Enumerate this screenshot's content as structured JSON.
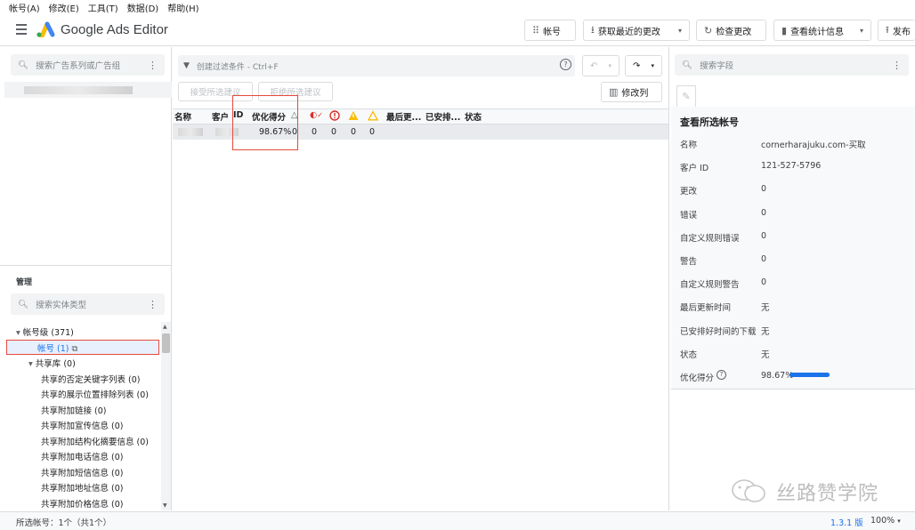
{
  "menu": [
    "帐号(A)",
    "修改(E)",
    "工具(T)",
    "数据(D)",
    "帮助(H)"
  ],
  "app_title": "Google Ads Editor",
  "toolbar": {
    "accounts": "帐号",
    "get_changes": "获取最近的更改",
    "check_changes": "检查更改",
    "view_stats": "查看统计信息",
    "publish": "发布"
  },
  "left": {
    "search_placeholder": "搜索广告系列或广告组",
    "manage_title": "管理",
    "entity_search_placeholder": "搜索实体类型",
    "tree": [
      {
        "label": "帐号级 (371)",
        "indent": 0,
        "arrow": "▾"
      },
      {
        "label": "帐号 (1)",
        "indent": 1,
        "arrow": "",
        "selected": true
      },
      {
        "label": "共享库 (0)",
        "indent": 1,
        "arrow": "▾"
      },
      {
        "label": "共享的否定关键字列表 (0)",
        "indent": 2
      },
      {
        "label": "共享的展示位置排除列表 (0)",
        "indent": 2
      },
      {
        "label": "共享附加链接 (0)",
        "indent": 2
      },
      {
        "label": "共享附加宣传信息 (0)",
        "indent": 2
      },
      {
        "label": "共享附加结构化摘要信息 (0)",
        "indent": 2
      },
      {
        "label": "共享附加电话信息 (0)",
        "indent": 2
      },
      {
        "label": "共享附加短信信息 (0)",
        "indent": 2
      },
      {
        "label": "共享附加地址信息 (0)",
        "indent": 2
      },
      {
        "label": "共享附加价格信息 (0)",
        "indent": 2
      }
    ]
  },
  "center": {
    "filter_placeholder": "创建过滤条件 - Ctrl+F",
    "accept_btn": "接受所选建议",
    "reject_btn": "拒绝所选建议",
    "edit_columns": "修改列",
    "columns": [
      "名称",
      "客户",
      "ID",
      "优化得分",
      "最后更...",
      "已安排...",
      "状态"
    ],
    "row": {
      "score": "98.67%",
      "counts": [
        "0",
        "0",
        "0",
        "0",
        "0"
      ]
    }
  },
  "right": {
    "search_placeholder": "搜索字段",
    "title": "查看所选帐号",
    "fields": [
      {
        "label": "名称",
        "value": "cornerharajuku.com-买取"
      },
      {
        "label": "客户 ID",
        "value": "121-527-5796"
      },
      {
        "label": "更改",
        "value": "0"
      },
      {
        "label": "错误",
        "value": "0"
      },
      {
        "label": "自定义规则错误",
        "value": "0"
      },
      {
        "label": "警告",
        "value": "0"
      },
      {
        "label": "自定义规则警告",
        "value": "0"
      },
      {
        "label": "最后更新时间",
        "value": "无"
      },
      {
        "label": "已安排好时间的下载",
        "value": "无"
      },
      {
        "label": "状态",
        "value": "无"
      },
      {
        "label": "优化得分",
        "value": "98.67%"
      }
    ],
    "score_fraction": 0.9867
  },
  "watermark": "丝路赞学院",
  "status": {
    "selected": "所选帐号：1个（共1个）",
    "version": "1.3.1 版",
    "zoom": "100%"
  },
  "colors": {
    "accent": "#1a73e8",
    "highlight": "#e64a3c",
    "warning": "#fbbc04",
    "error": "#d93025"
  }
}
